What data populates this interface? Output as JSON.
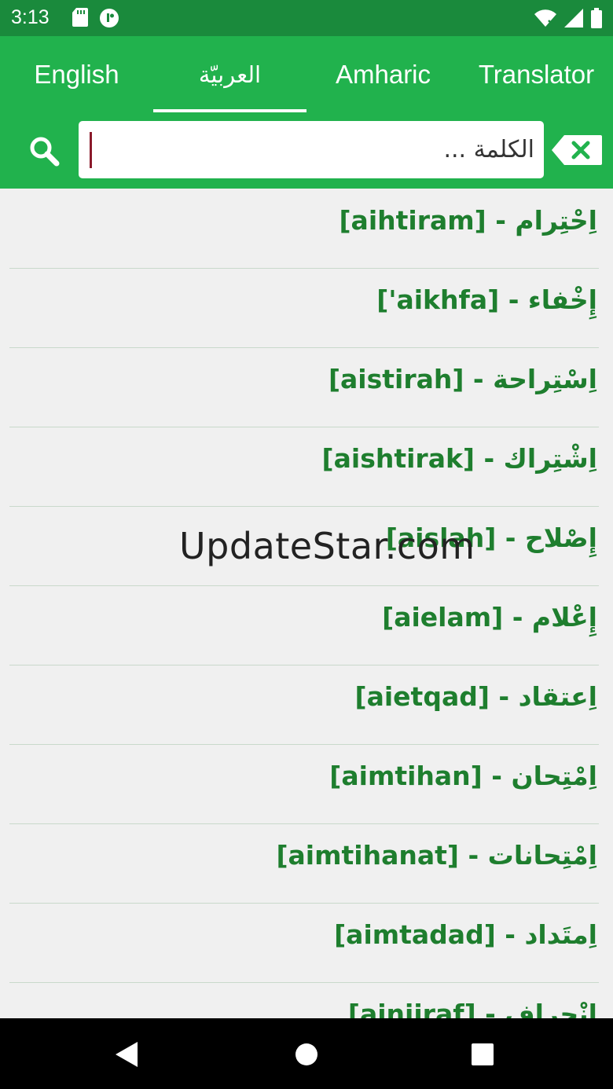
{
  "status_bar": {
    "time": "3:13",
    "icons": [
      "sd-card-icon",
      "app-notification-icon",
      "wifi-icon",
      "signal-icon",
      "battery-icon"
    ]
  },
  "tabs": [
    {
      "label": "English",
      "selected": false
    },
    {
      "label": "العربيّة",
      "selected": true
    },
    {
      "label": "Amharic",
      "selected": false
    },
    {
      "label": "Translator",
      "selected": false
    }
  ],
  "search": {
    "placeholder": "الكلمة ...",
    "value": ""
  },
  "words": [
    {
      "text": "[aihtiram]  -  اِحْتِرام"
    },
    {
      "text": "['aikhfa]  -  إِخْفاء"
    },
    {
      "text": "[aistirah]  -  اِسْتِراحة"
    },
    {
      "text": "[aishtirak]  -  اِشْتِراك"
    },
    {
      "text": "[aislah]  -  إِصْلاح"
    },
    {
      "text": "[aielam]  -  إِعْلام"
    },
    {
      "text": "[aietqad]  -  اِعتقاد"
    },
    {
      "text": "[aimtihan]  -  اِمْتِحان"
    },
    {
      "text": "[aimtihanat]  -  اِمْتِحانات"
    },
    {
      "text": "[aimtadad]  -  اِمتَداد"
    },
    {
      "text": "[ainjiraf]  -  اِنْجِراف"
    }
  ],
  "watermark": "UpdateStar.com",
  "colors": {
    "status_bar": "#1a8a3c",
    "app_bar": "#21b24d",
    "word_text": "#1e7e2e",
    "background": "#f0f0f0"
  }
}
